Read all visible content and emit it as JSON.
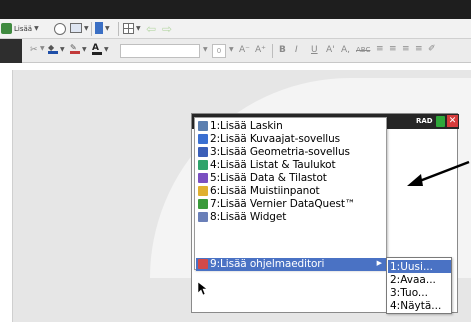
{
  "toolbar": {
    "insert_label": "Lisää",
    "font_size_value": "0"
  },
  "status": {
    "angle_mode": "RAD"
  },
  "insert_menu": {
    "items": [
      {
        "label": "1:Lisää Laskin",
        "icon": "calculator-icon",
        "color": "#5b7fb0"
      },
      {
        "label": "2:Lisää Kuvaajat-sovellus",
        "icon": "graphs-icon",
        "color": "#3a6fd1"
      },
      {
        "label": "3:Lisää Geometria-sovellus",
        "icon": "geometry-icon",
        "color": "#3b5fb8"
      },
      {
        "label": "4:Lisää Listat & Taulukot",
        "icon": "lists-spreadsheet-icon",
        "color": "#2fa36b"
      },
      {
        "label": "5:Lisää Data & Tilastot",
        "icon": "data-statistics-icon",
        "color": "#7a4fc1"
      },
      {
        "label": "6:Lisää Muistiinpanot",
        "icon": "notes-icon",
        "color": "#e0b030"
      },
      {
        "label": "7:Lisää Vernier DataQuest™",
        "icon": "vernier-dataquest-icon",
        "color": "#3a9a3a"
      },
      {
        "label": "8:Lisää Widget",
        "icon": "widget-icon",
        "color": "#6a7fb8"
      },
      {
        "label": "9:Lisää ohjelmaeditori",
        "icon": "program-editor-icon",
        "color": "#d24a4a"
      }
    ]
  },
  "program_submenu": {
    "items": [
      {
        "label": "1:Uusi..."
      },
      {
        "label": "2:Avaa..."
      },
      {
        "label": "3:Tuo..."
      },
      {
        "label": "4:Näytä..."
      }
    ]
  },
  "colors": {
    "selection": "#4a72c4",
    "title_bar": "#262626"
  }
}
